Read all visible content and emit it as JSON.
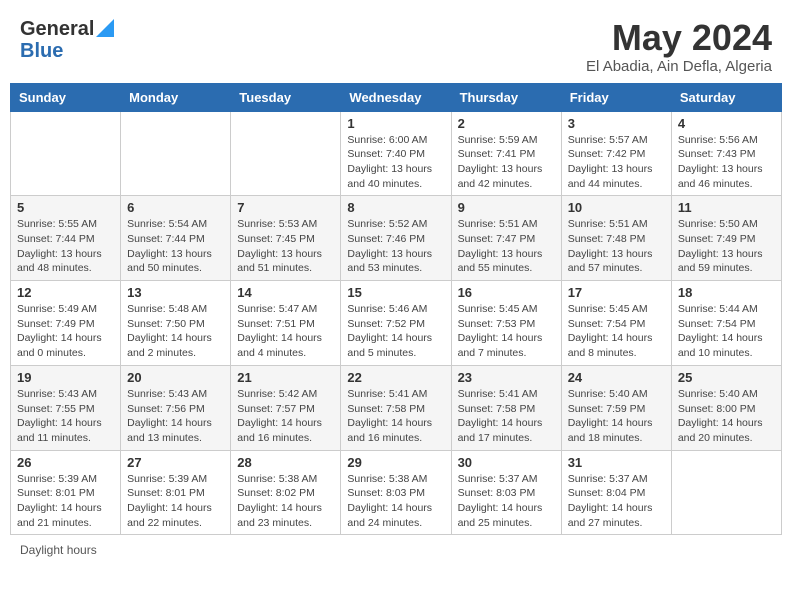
{
  "header": {
    "logo_line1": "General",
    "logo_line2": "Blue",
    "month_title": "May 2024",
    "location": "El Abadia, Ain Defla, Algeria"
  },
  "footer": {
    "daylight_label": "Daylight hours"
  },
  "days_of_week": [
    "Sunday",
    "Monday",
    "Tuesday",
    "Wednesday",
    "Thursday",
    "Friday",
    "Saturday"
  ],
  "weeks": [
    [
      {
        "day": "",
        "info": ""
      },
      {
        "day": "",
        "info": ""
      },
      {
        "day": "",
        "info": ""
      },
      {
        "day": "1",
        "info": "Sunrise: 6:00 AM\nSunset: 7:40 PM\nDaylight: 13 hours\nand 40 minutes."
      },
      {
        "day": "2",
        "info": "Sunrise: 5:59 AM\nSunset: 7:41 PM\nDaylight: 13 hours\nand 42 minutes."
      },
      {
        "day": "3",
        "info": "Sunrise: 5:57 AM\nSunset: 7:42 PM\nDaylight: 13 hours\nand 44 minutes."
      },
      {
        "day": "4",
        "info": "Sunrise: 5:56 AM\nSunset: 7:43 PM\nDaylight: 13 hours\nand 46 minutes."
      }
    ],
    [
      {
        "day": "5",
        "info": "Sunrise: 5:55 AM\nSunset: 7:44 PM\nDaylight: 13 hours\nand 48 minutes."
      },
      {
        "day": "6",
        "info": "Sunrise: 5:54 AM\nSunset: 7:44 PM\nDaylight: 13 hours\nand 50 minutes."
      },
      {
        "day": "7",
        "info": "Sunrise: 5:53 AM\nSunset: 7:45 PM\nDaylight: 13 hours\nand 51 minutes."
      },
      {
        "day": "8",
        "info": "Sunrise: 5:52 AM\nSunset: 7:46 PM\nDaylight: 13 hours\nand 53 minutes."
      },
      {
        "day": "9",
        "info": "Sunrise: 5:51 AM\nSunset: 7:47 PM\nDaylight: 13 hours\nand 55 minutes."
      },
      {
        "day": "10",
        "info": "Sunrise: 5:51 AM\nSunset: 7:48 PM\nDaylight: 13 hours\nand 57 minutes."
      },
      {
        "day": "11",
        "info": "Sunrise: 5:50 AM\nSunset: 7:49 PM\nDaylight: 13 hours\nand 59 minutes."
      }
    ],
    [
      {
        "day": "12",
        "info": "Sunrise: 5:49 AM\nSunset: 7:49 PM\nDaylight: 14 hours\nand 0 minutes."
      },
      {
        "day": "13",
        "info": "Sunrise: 5:48 AM\nSunset: 7:50 PM\nDaylight: 14 hours\nand 2 minutes."
      },
      {
        "day": "14",
        "info": "Sunrise: 5:47 AM\nSunset: 7:51 PM\nDaylight: 14 hours\nand 4 minutes."
      },
      {
        "day": "15",
        "info": "Sunrise: 5:46 AM\nSunset: 7:52 PM\nDaylight: 14 hours\nand 5 minutes."
      },
      {
        "day": "16",
        "info": "Sunrise: 5:45 AM\nSunset: 7:53 PM\nDaylight: 14 hours\nand 7 minutes."
      },
      {
        "day": "17",
        "info": "Sunrise: 5:45 AM\nSunset: 7:54 PM\nDaylight: 14 hours\nand 8 minutes."
      },
      {
        "day": "18",
        "info": "Sunrise: 5:44 AM\nSunset: 7:54 PM\nDaylight: 14 hours\nand 10 minutes."
      }
    ],
    [
      {
        "day": "19",
        "info": "Sunrise: 5:43 AM\nSunset: 7:55 PM\nDaylight: 14 hours\nand 11 minutes."
      },
      {
        "day": "20",
        "info": "Sunrise: 5:43 AM\nSunset: 7:56 PM\nDaylight: 14 hours\nand 13 minutes."
      },
      {
        "day": "21",
        "info": "Sunrise: 5:42 AM\nSunset: 7:57 PM\nDaylight: 14 hours\nand 16 minutes."
      },
      {
        "day": "22",
        "info": "Sunrise: 5:41 AM\nSunset: 7:58 PM\nDaylight: 14 hours\nand 16 minutes."
      },
      {
        "day": "23",
        "info": "Sunrise: 5:41 AM\nSunset: 7:58 PM\nDaylight: 14 hours\nand 17 minutes."
      },
      {
        "day": "24",
        "info": "Sunrise: 5:40 AM\nSunset: 7:59 PM\nDaylight: 14 hours\nand 18 minutes."
      },
      {
        "day": "25",
        "info": "Sunrise: 5:40 AM\nSunset: 8:00 PM\nDaylight: 14 hours\nand 20 minutes."
      }
    ],
    [
      {
        "day": "26",
        "info": "Sunrise: 5:39 AM\nSunset: 8:01 PM\nDaylight: 14 hours\nand 21 minutes."
      },
      {
        "day": "27",
        "info": "Sunrise: 5:39 AM\nSunset: 8:01 PM\nDaylight: 14 hours\nand 22 minutes."
      },
      {
        "day": "28",
        "info": "Sunrise: 5:38 AM\nSunset: 8:02 PM\nDaylight: 14 hours\nand 23 minutes."
      },
      {
        "day": "29",
        "info": "Sunrise: 5:38 AM\nSunset: 8:03 PM\nDaylight: 14 hours\nand 24 minutes."
      },
      {
        "day": "30",
        "info": "Sunrise: 5:37 AM\nSunset: 8:03 PM\nDaylight: 14 hours\nand 25 minutes."
      },
      {
        "day": "31",
        "info": "Sunrise: 5:37 AM\nSunset: 8:04 PM\nDaylight: 14 hours\nand 27 minutes."
      },
      {
        "day": "",
        "info": ""
      }
    ]
  ]
}
